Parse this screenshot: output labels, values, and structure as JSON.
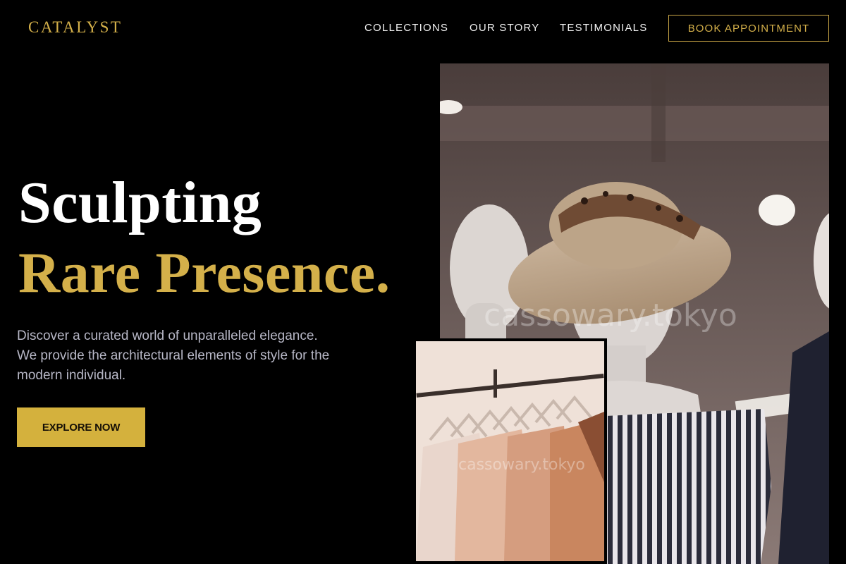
{
  "header": {
    "logo": "CATALYST",
    "nav": [
      "COLLECTIONS",
      "OUR STORY",
      "TESTIMONIALS"
    ],
    "cta": "BOOK APPOINTMENT"
  },
  "hero": {
    "line1": "Sculpting",
    "line2": "Rare Presence.",
    "description": "Discover a curated world of unparalleled elegance. We provide the architectural elements of style for the modern individual.",
    "button": "EXPLORE NOW"
  },
  "images": {
    "main_watermark": "cassowary.tokyo",
    "small_watermark": "cassowary.tokyo"
  },
  "colors": {
    "background": "#000000",
    "accent": "#d4b04a",
    "button": "#d4b13d",
    "body_text": "#b7b7c6"
  }
}
